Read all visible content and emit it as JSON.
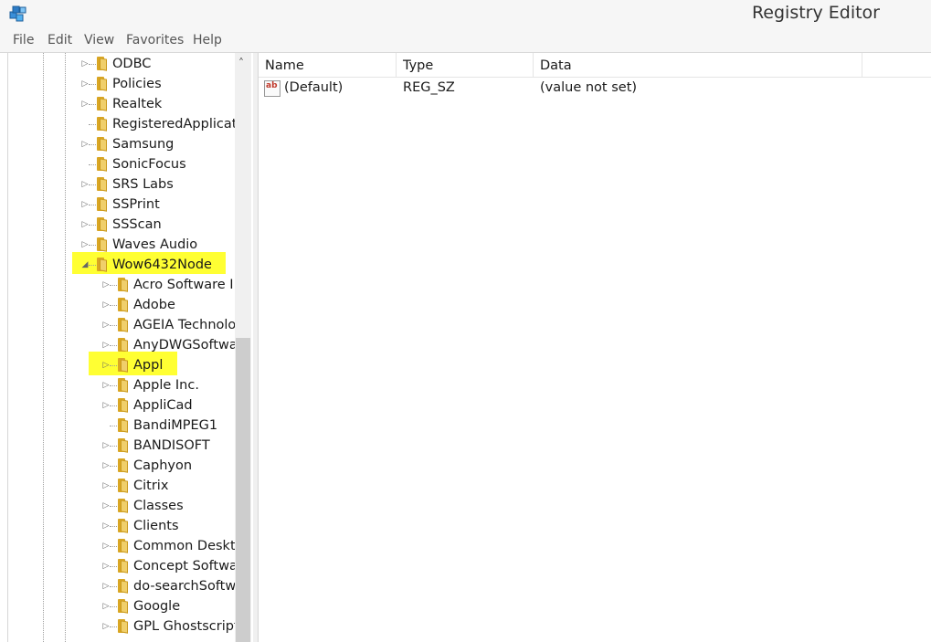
{
  "window": {
    "title": "Registry Editor"
  },
  "menu": [
    "File",
    "Edit",
    "View",
    "Favorites",
    "Help"
  ],
  "tree": {
    "items": [
      {
        "label": "ODBC",
        "expander": "closed",
        "highlight": false
      },
      {
        "label": "Policies",
        "expander": "closed",
        "highlight": false
      },
      {
        "label": "Realtek",
        "expander": "closed",
        "highlight": false
      },
      {
        "label": "RegisteredApplicat",
        "expander": "none",
        "highlight": false
      },
      {
        "label": "Samsung",
        "expander": "closed",
        "highlight": false
      },
      {
        "label": "SonicFocus",
        "expander": "none",
        "highlight": false
      },
      {
        "label": "SRS Labs",
        "expander": "closed",
        "highlight": false
      },
      {
        "label": "SSPrint",
        "expander": "closed",
        "highlight": false
      },
      {
        "label": "SSScan",
        "expander": "closed",
        "highlight": false
      },
      {
        "label": "Waves Audio",
        "expander": "closed",
        "highlight": false
      },
      {
        "label": "Wow6432Node",
        "expander": "open",
        "highlight": true
      },
      {
        "label": "Acro Software I",
        "expander": "closed",
        "highlight": false
      },
      {
        "label": "Adobe",
        "expander": "closed",
        "highlight": false
      },
      {
        "label": "AGEIA Technolo",
        "expander": "closed",
        "highlight": false
      },
      {
        "label": "AnyDWGSoftwa",
        "expander": "closed",
        "highlight": false
      },
      {
        "label": "Appl",
        "expander": "closed",
        "highlight": true
      },
      {
        "label": "Apple Inc.",
        "expander": "closed",
        "highlight": false
      },
      {
        "label": "AppliCad",
        "expander": "closed",
        "highlight": false
      },
      {
        "label": "BandiMPEG1",
        "expander": "none",
        "highlight": false
      },
      {
        "label": "BANDISOFT",
        "expander": "closed",
        "highlight": false
      },
      {
        "label": "Caphyon",
        "expander": "closed",
        "highlight": false
      },
      {
        "label": "Citrix",
        "expander": "closed",
        "highlight": false
      },
      {
        "label": "Classes",
        "expander": "closed",
        "highlight": false
      },
      {
        "label": "Clients",
        "expander": "closed",
        "highlight": false
      },
      {
        "label": "Common Deskt",
        "expander": "closed",
        "highlight": false
      },
      {
        "label": "Concept Softwa",
        "expander": "closed",
        "highlight": false
      },
      {
        "label": "do-searchSoftw",
        "expander": "closed",
        "highlight": false
      },
      {
        "label": "Google",
        "expander": "closed",
        "highlight": false
      },
      {
        "label": "GPL Ghostscript",
        "expander": "closed",
        "highlight": false
      }
    ]
  },
  "list": {
    "columns": [
      "Name",
      "Type",
      "Data"
    ],
    "rows": [
      {
        "name": "(Default)",
        "type": "REG_SZ",
        "data": "(value not set)",
        "icon": "string-value-icon"
      }
    ]
  },
  "colors": {
    "highlight": "#ffff33",
    "folder": "#f0cf6b"
  }
}
